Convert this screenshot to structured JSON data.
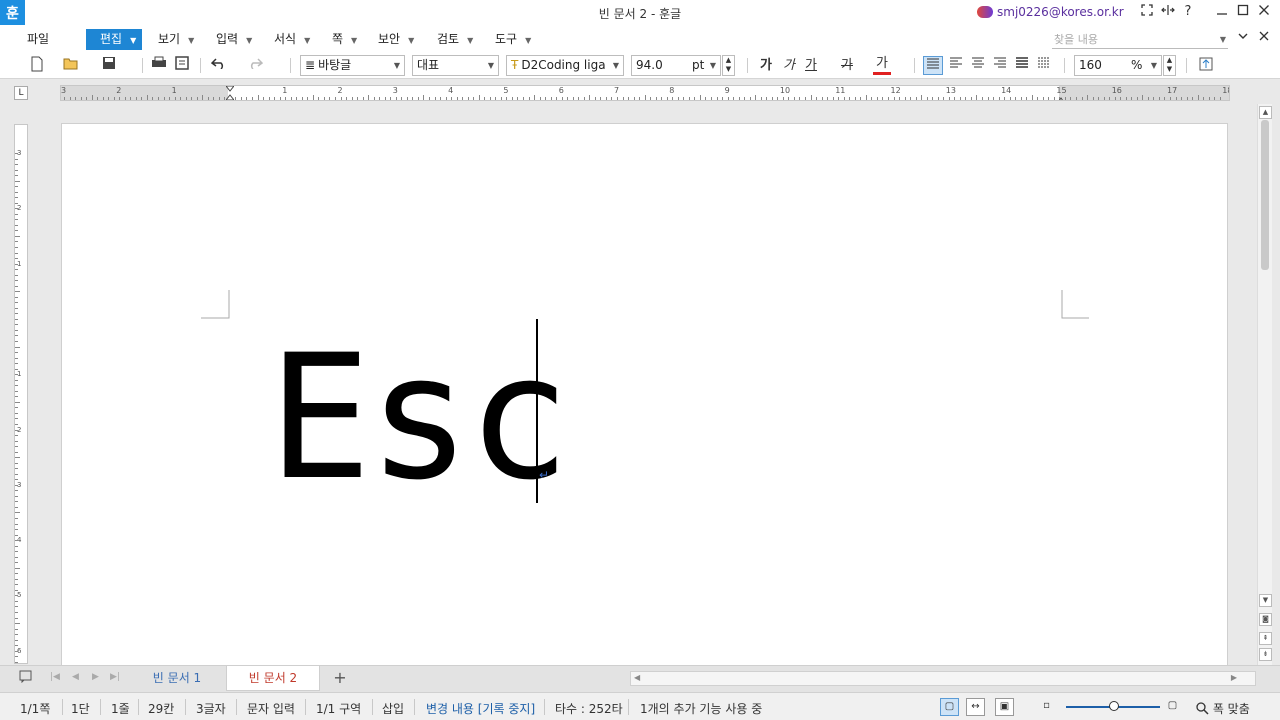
{
  "titlebar": {
    "app_logo": "훈",
    "title": "빈 문서 2 - 훈글",
    "account": "smj0226@kores.or.kr",
    "icons": [
      "fullscreen-icon",
      "resize-icon",
      "help-icon",
      "minimize-icon",
      "maximize-icon",
      "close-icon"
    ],
    "help_glyph": "?"
  },
  "menubar": {
    "items": [
      {
        "label": "파일"
      },
      {
        "label": "편집"
      },
      {
        "label": "보기"
      },
      {
        "label": "입력"
      },
      {
        "label": "서식"
      },
      {
        "label": "쪽"
      },
      {
        "label": "보안"
      },
      {
        "label": "검토"
      },
      {
        "label": "도구"
      }
    ],
    "active": "편집",
    "search_placeholder": "찾을 내용"
  },
  "toolbar": {
    "style_name": "바탕글",
    "lang_font": "대표",
    "font_name": "D2Coding liga",
    "font_size": "94.0",
    "font_unit": "pt",
    "bold": "가",
    "italic": "가",
    "underline": "가",
    "strike": "가",
    "font_color_glyph": "가",
    "font_color": "#e02020",
    "line_spacing": "160",
    "line_spacing_unit": "%"
  },
  "ruler": {
    "corner": "L",
    "h_labels": [
      "3",
      "2",
      "1",
      "",
      "1",
      "2",
      "3",
      "4",
      "5",
      "6",
      "7",
      "8",
      "9",
      "10",
      "11",
      "12",
      "13",
      "14",
      "15",
      "16",
      "17",
      "18"
    ],
    "v_labels": [
      "3",
      "2",
      "1",
      "",
      "1",
      "2",
      "3",
      "4",
      "5",
      "6"
    ]
  },
  "document": {
    "text": "Esc",
    "para_mark": "↵"
  },
  "tabs": {
    "items": [
      {
        "label": "빈 문서 1"
      },
      {
        "label": "빈 문서 2"
      }
    ],
    "active": "빈 문서 2",
    "add": "+"
  },
  "statusbar": {
    "page": "1/1쪽",
    "column": "1단",
    "line": "1줄",
    "col": "29칸",
    "chars": "3글자",
    "input_mode": "문자 입력",
    "section": "1/1 구역",
    "insert_mode": "삽입",
    "track_changes": "변경 내용 [기록 중지]",
    "keystrokes": "타수 : 252타",
    "addon": "1개의 추가 기능 사용 중",
    "fit": "폭 맞춤",
    "track_color": "#1d5fa8"
  }
}
